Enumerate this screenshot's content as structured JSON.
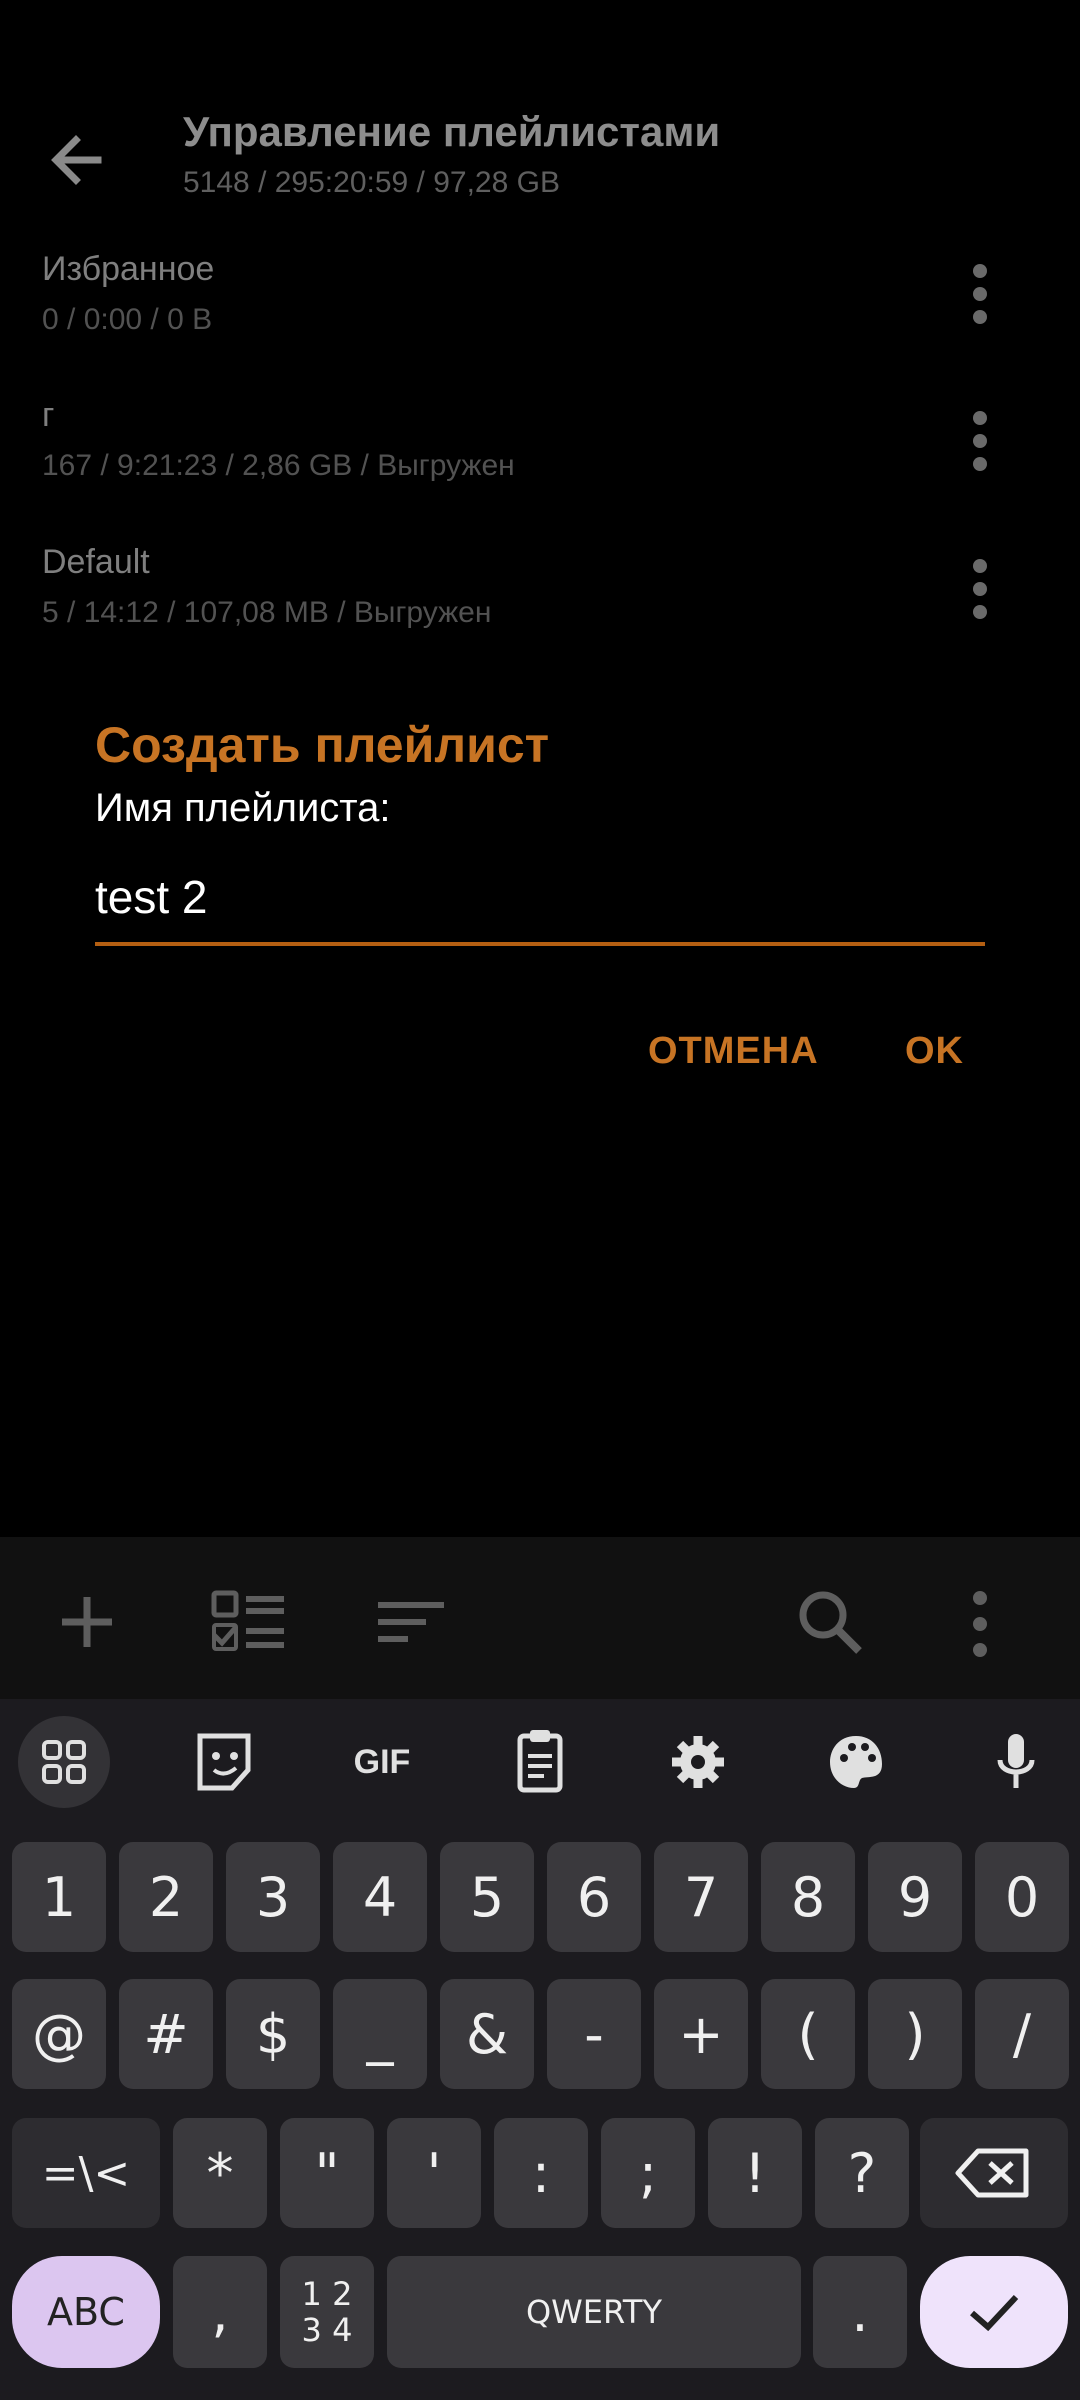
{
  "header": {
    "title": "Управление плейлистами",
    "subtitle": "5148 / 295:20:59 / 97,28 GB"
  },
  "playlists": [
    {
      "name": "Избранное",
      "meta": "0 / 0:00 / 0 B"
    },
    {
      "name": "г",
      "meta": "167 / 9:21:23 / 2,86 GB / Выгружен"
    },
    {
      "name": "Default",
      "meta": "5 / 14:12 / 107,08 MB / Выгружен"
    }
  ],
  "dialog": {
    "title": "Создать плейлист",
    "label": "Имя плейлиста:",
    "input_value": "test 2",
    "cancel": "ОТМЕНА",
    "ok": "OK"
  },
  "toolbar": {
    "icons": [
      "add-icon",
      "checklist-icon",
      "sort-icon",
      "search-icon",
      "more-vert-icon"
    ]
  },
  "keyboard": {
    "suggestion_icons": [
      "apps-grid-icon",
      "sticker-icon",
      "gif-icon",
      "clipboard-icon",
      "settings-icon",
      "palette-icon",
      "mic-icon"
    ],
    "gif_label": "GIF",
    "row1": [
      "1",
      "2",
      "3",
      "4",
      "5",
      "6",
      "7",
      "8",
      "9",
      "0"
    ],
    "row2": [
      "@",
      "#",
      "$",
      "_",
      "&",
      "-",
      "+",
      "(",
      ")",
      "/"
    ],
    "row3": [
      "*",
      "\"",
      "'",
      ":",
      ";",
      "!",
      "?"
    ],
    "row3_mod": "=\\<",
    "bottom": {
      "abc": "ABC",
      "comma": ",",
      "num_top": "1 2",
      "num_bottom": "3 4",
      "space": "QWERTY",
      "period": "."
    }
  },
  "colors": {
    "accent": "#c77424",
    "background": "#000000",
    "keyboard": "#1c1b1f"
  }
}
